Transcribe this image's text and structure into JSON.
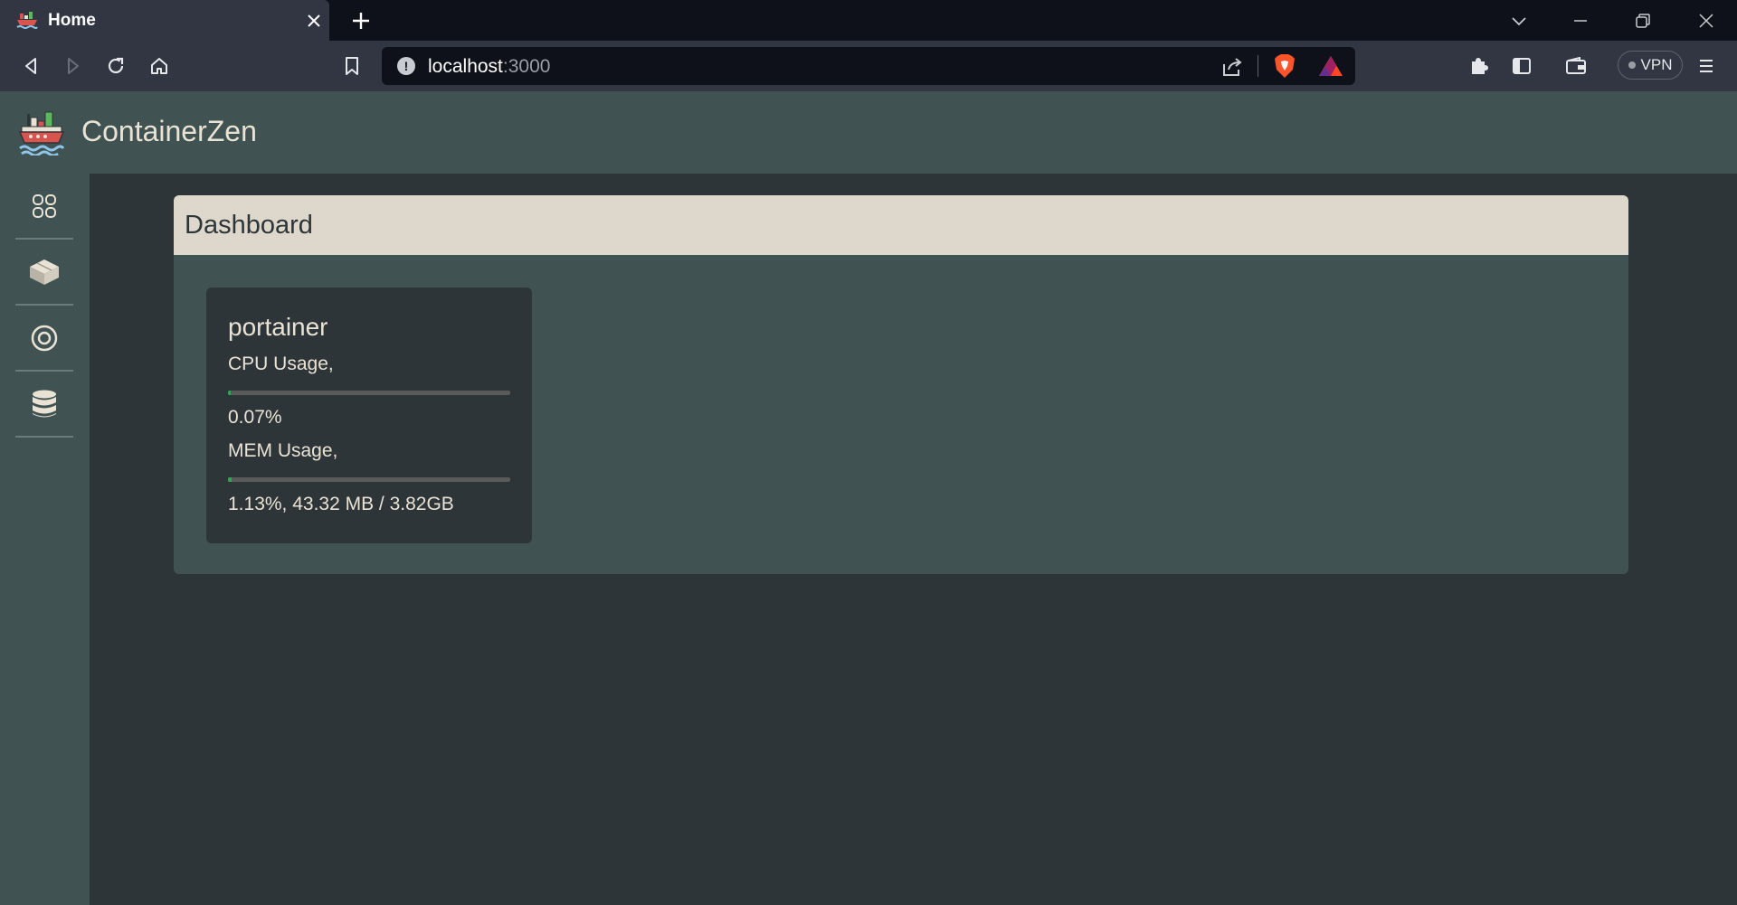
{
  "browser": {
    "tab_title": "Home",
    "url_host": "localhost",
    "url_port": ":3000",
    "vpn_label": "VPN"
  },
  "app": {
    "name": "ContainerZen",
    "sidebar": [
      {
        "icon": "grid-icon"
      },
      {
        "icon": "box-icon"
      },
      {
        "icon": "target-icon"
      },
      {
        "icon": "database-icon"
      }
    ]
  },
  "dashboard": {
    "title": "Dashboard",
    "containers": [
      {
        "name": "portainer",
        "cpu_label": "CPU Usage,",
        "cpu_value": "0.07%",
        "cpu_fraction": 0.0007,
        "mem_label": "MEM Usage,",
        "mem_value": "1.13%, 43.32 MB / 3.82GB",
        "mem_fraction": 0.0113
      }
    ]
  },
  "colors": {
    "header_bg": "#405252",
    "page_bg": "#2e3538",
    "card_header_bg": "#ddd8cb",
    "text_light": "#e9e3d5",
    "bar_fill": "#2ea84f"
  }
}
